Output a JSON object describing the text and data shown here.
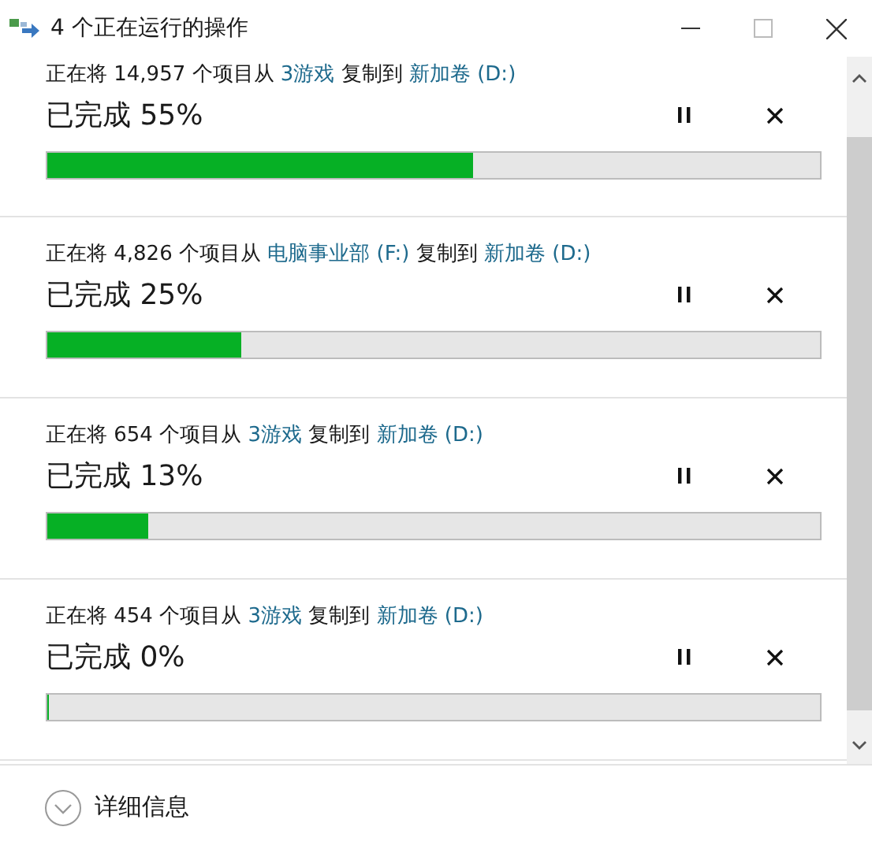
{
  "window": {
    "title": "4 个正在运行的操作"
  },
  "operations": [
    {
      "prefix": "正在将 14,957 个项目从",
      "source": "3游戏",
      "middle": "复制到",
      "destination": "新加卷 (D:)",
      "progress": "已完成 55%",
      "level": 0.55
    },
    {
      "prefix": "正在将 4,826 个项目从",
      "source": "电脑事业部 (F:)",
      "middle": "复制到",
      "destination": "新加卷 (D:)",
      "progress": "已完成 25%",
      "level": 0.25
    },
    {
      "prefix": "正在将 654 个项目从",
      "source": "3游戏",
      "middle": "复制到",
      "destination": "新加卷 (D:)",
      "progress": "已完成 13%",
      "level": 0.13
    },
    {
      "prefix": "正在将 454 个项目从",
      "source": "3游戏",
      "middle": "复制到",
      "destination": "新加卷 (D:)",
      "progress": "已完成 0%",
      "level": 0
    }
  ],
  "footer": {
    "details_label": "详细信息",
    "expanded": false
  }
}
